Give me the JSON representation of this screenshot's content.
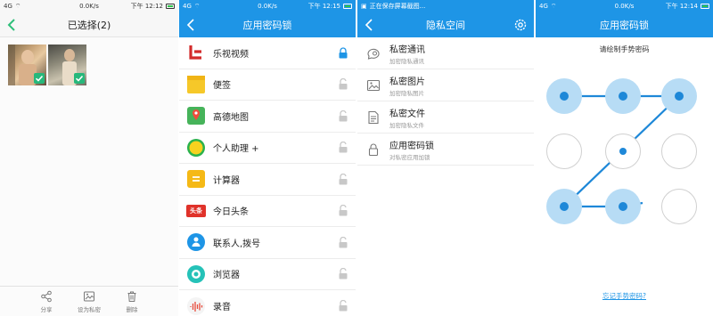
{
  "colors": {
    "accent": "#1e95e6",
    "check_green": "#27b87b",
    "dot_blue": "#1e88d8",
    "ring_blue": "#b7dcf5"
  },
  "panel1": {
    "status": {
      "signal": "4G",
      "speed": "0.0K/s",
      "time": "下午 12:12"
    },
    "title": "已选择(2)",
    "back_icon": "back-chevron-icon",
    "thumbnails": [
      {
        "checked": true
      },
      {
        "checked": true
      }
    ],
    "bottom_actions": [
      {
        "label": "分享",
        "icon": "share-icon"
      },
      {
        "label": "设为私密",
        "icon": "private-photo-icon"
      },
      {
        "label": "删除",
        "icon": "trash-icon"
      }
    ]
  },
  "panel2": {
    "status": {
      "signal": "4G",
      "speed": "0.0K/s",
      "time": "下午 12:15"
    },
    "title": "应用密码锁",
    "apps": [
      {
        "name": "乐视视频",
        "icon": "letv-icon",
        "locked": true
      },
      {
        "name": "便签",
        "icon": "notes-icon",
        "locked": false
      },
      {
        "name": "高德地图",
        "icon": "map-icon",
        "locked": false
      },
      {
        "name": "个人助理 +",
        "icon": "assistant-icon",
        "locked": false
      },
      {
        "name": "计算器",
        "icon": "calculator-icon",
        "locked": false
      },
      {
        "name": "今日头条",
        "icon": "toutiao-icon",
        "locked": false
      },
      {
        "name": "联系人,拨号",
        "icon": "contacts-icon",
        "locked": false
      },
      {
        "name": "浏览器",
        "icon": "browser-icon",
        "locked": false
      },
      {
        "name": "录音",
        "icon": "recorder-icon",
        "locked": false
      }
    ],
    "toutiao_badge": "头条"
  },
  "panel3": {
    "status": {
      "notice": "正在保存屏幕截图..."
    },
    "title": "隐私空间",
    "items": [
      {
        "title": "私密通讯",
        "sub": "加密隐私通讯",
        "icon": "chat-icon"
      },
      {
        "title": "私密图片",
        "sub": "加密隐私图片",
        "icon": "image-icon"
      },
      {
        "title": "私密文件",
        "sub": "加密隐私文件",
        "icon": "file-icon"
      },
      {
        "title": "应用密码锁",
        "sub": "对私密应用加锁",
        "icon": "padlock-icon"
      }
    ]
  },
  "panel4": {
    "status": {
      "signal": "4G",
      "speed": "0.0K/s",
      "time": "下午 12:14"
    },
    "title": "应用密码锁",
    "prompt": "请绘制手势密码",
    "forgot": "忘记手势密码?",
    "pattern_active": [
      true,
      true,
      true,
      false,
      false,
      false,
      true,
      true,
      false
    ]
  }
}
